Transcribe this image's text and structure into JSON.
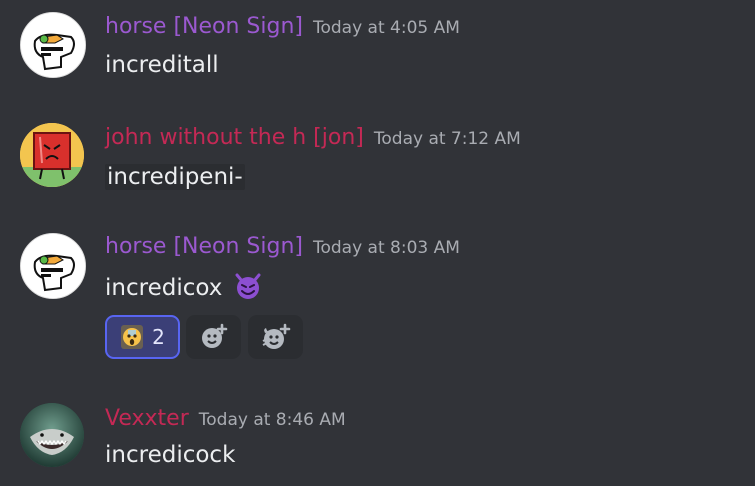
{
  "messages": [
    {
      "author": "horse [Neon Sign]",
      "author_color": "#9b59d0",
      "time": "Today at 4:05 AM",
      "text": "increditall",
      "avatar": "horse-avatar"
    },
    {
      "author": "john without the h [jon]",
      "author_color": "#c42955",
      "time": "Today at 7:12 AM",
      "text": "incredipeni-",
      "avatar": "red-block-avatar"
    },
    {
      "author": "horse [Neon Sign]",
      "author_color": "#9b59d0",
      "time": "Today at 8:03 AM",
      "text": "incredicox",
      "emoji": "smiling-devil-emoji",
      "avatar": "horse-avatar",
      "reactions": [
        {
          "emoji": "screaming-face-emoji",
          "count": "2",
          "active": true
        }
      ],
      "add_reaction_icons": [
        "add-reaction-icon",
        "add-super-reaction-icon"
      ]
    },
    {
      "author": "Vexxter",
      "author_color": "#c42955",
      "time": "Today at 8:46 AM",
      "text": "incredicock",
      "avatar": "shark-avatar"
    }
  ],
  "colors": {
    "background": "#313338",
    "timestamp": "#a9acb2",
    "reaction_active_border": "#5865f2"
  }
}
